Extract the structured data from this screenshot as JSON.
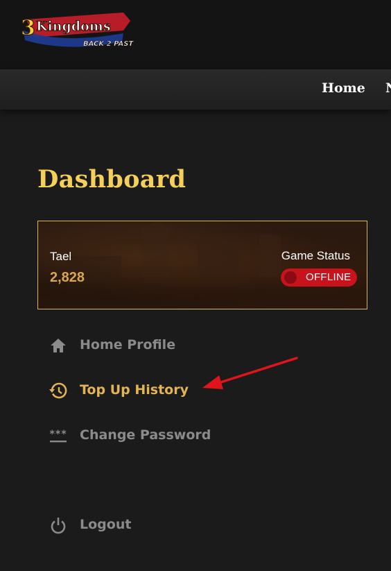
{
  "brand": {
    "logo_main": "Kingdoms",
    "logo_number": "3",
    "logo_sub": "BACK 2 PAST"
  },
  "nav": {
    "items": [
      {
        "label": "Home"
      },
      {
        "label": "N"
      }
    ]
  },
  "page": {
    "title": "Dashboard"
  },
  "account": {
    "tael_label": "Tael",
    "tael_value": "2,828",
    "status_label": "Game Status",
    "status_value": "OFFLINE"
  },
  "menu": {
    "items": [
      {
        "label": "Home Profile",
        "icon": "home-icon"
      },
      {
        "label": "Top Up History",
        "icon": "history-icon",
        "active": true
      },
      {
        "label": "Change Password",
        "icon": "password-icon"
      },
      {
        "label": "Logout",
        "icon": "power-icon"
      }
    ]
  },
  "colors": {
    "accent_gold": "#f4cf5a",
    "menu_active": "#e3b456",
    "menu_inactive": "#8b8b8b",
    "status_offline": "#c8121c",
    "annotation_arrow": "#e2141b"
  }
}
